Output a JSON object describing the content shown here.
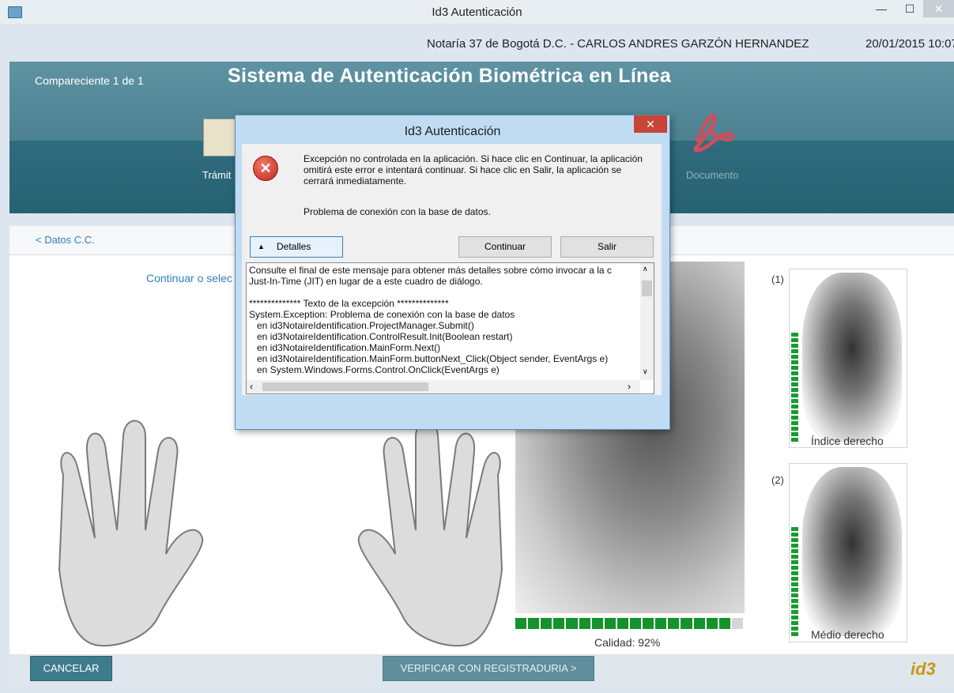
{
  "window": {
    "title": "Id3 Autenticación",
    "min_glyph": "—",
    "max_glyph": "☐",
    "close_glyph": "✕",
    "icon": "app-icon"
  },
  "infobar": {
    "notary": "Notaría 37 de Bogotá D.C. - CARLOS ANDRES GARZÓN HERNANDEZ",
    "datetime": "20/01/2015 10:07"
  },
  "header": {
    "compareciente": "Compareciente 1 de 1",
    "title": "Sistema de Autenticación Biométrica en Línea",
    "step1": "Trámit",
    "step_doc": "Documento"
  },
  "main": {
    "crumb": "< Datos C.C.",
    "instruction": "Continuar o selec",
    "quality": "Calidad: 92%",
    "quality_fraction": 0.92,
    "finger1_num": "(1)",
    "finger1_label": "Índice derecho",
    "finger2_num": "(2)",
    "finger2_label": "Médio derecho"
  },
  "footer": {
    "cancel": "CANCELAR",
    "verify": "VERIFICAR CON REGISTRADURIA >",
    "brand": "id3"
  },
  "dialog": {
    "title": "Id3 Autenticación",
    "close_glyph": "✕",
    "icon": "error-icon",
    "message": "Excepción no controlada en la aplicación. Si hace clic en Continuar, la aplicación omitirá este error e intentará continuar. Si hace clic en Salir, la aplicación se cerrará inmediatamente.",
    "message2": "Problema de conexión con la base de datos.",
    "details_label": "Detalles",
    "continue_label": "Continuar",
    "exit_label": "Salir",
    "details_text": "Consulte el final de este mensaje para obtener más detalles sobre cómo invocar a la c\nJust-In-Time (JIT) en lugar de a este cuadro de diálogo.\n\n************** Texto de la excepción **************\nSystem.Exception: Problema de conexión con la base de datos\n   en id3NotaireIdentification.ProjectManager.Submit()\n   en id3NotaireIdentification.ControlResult.Init(Boolean restart)\n   en id3NotaireIdentification.MainForm.Next()\n   en id3NotaireIdentification.MainForm.buttonNext_Click(Object sender, EventArgs e)\n   en System.Windows.Forms.Control.OnClick(EventArgs e)"
  }
}
